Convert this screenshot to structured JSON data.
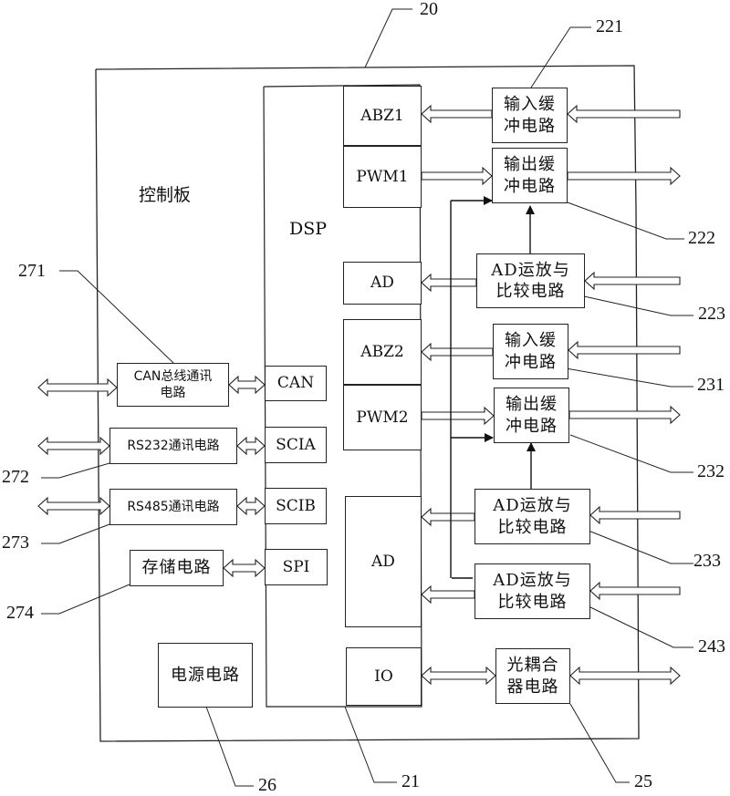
{
  "diagram": {
    "board_title": "控制板",
    "dsp_title": "DSP",
    "dsp_ports": {
      "abz1": "ABZ1",
      "pwm1": "PWM1",
      "ad1": "AD",
      "abz2": "ABZ2",
      "pwm2": "PWM2",
      "ad2": "AD",
      "io": "IO",
      "can": "CAN",
      "scia": "SCIA",
      "scib": "SCIB",
      "spi": "SPI"
    },
    "circuits": {
      "input_buffer_1": "输入缓\n冲电路",
      "output_buffer_1": "输出缓\n冲电路",
      "ad_opamp_1": "AD运放与\n比较电路",
      "input_buffer_2": "输入缓\n冲电路",
      "output_buffer_2": "输出缓\n冲电路",
      "ad_opamp_2": "AD运放与\n比较电路",
      "ad_opamp_3": "AD运放与\n比较电路",
      "optocoupler": "光耦合\n器电路",
      "can_bus": "CAN总线通讯\n电路",
      "rs232": "RS232通讯电路",
      "rs485": "RS485通讯电路",
      "storage": "存储电路",
      "power": "电源电路"
    },
    "reference_numbers": {
      "board": "20",
      "dsp": "21",
      "input_buffer_1": "221",
      "output_buffer_1": "222",
      "ad_opamp_1": "223",
      "input_buffer_2": "231",
      "output_buffer_2": "232",
      "ad_opamp_2": "233",
      "ad_opamp_3": "243",
      "optocoupler": "25",
      "power": "26",
      "can_bus": "271",
      "rs232": "272",
      "rs485": "273",
      "storage": "274"
    }
  }
}
